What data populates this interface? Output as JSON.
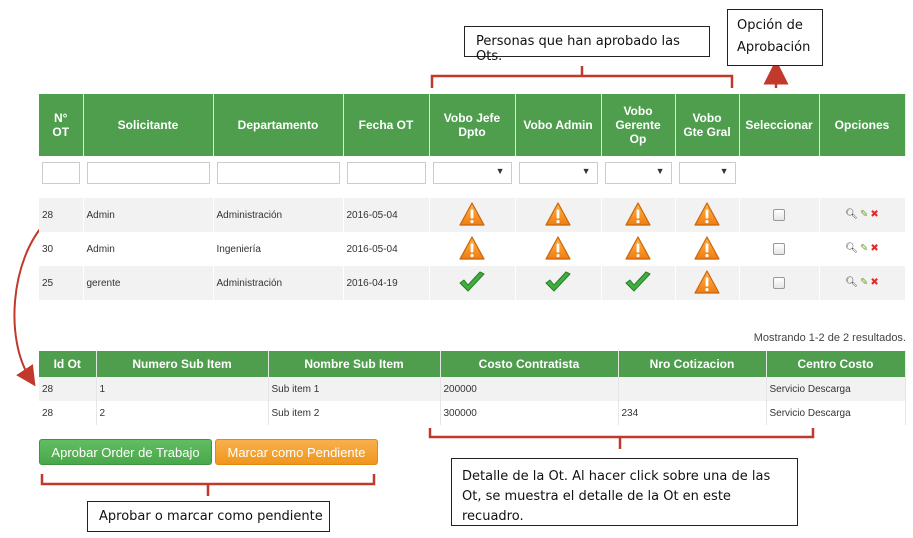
{
  "callouts": {
    "personas": "Personas que han aprobado las Ots.",
    "opcion": "Opción de Aprobación",
    "detalle": "Detalle de la Ot. Al hacer click sobre una de las Ot, se muestra el detalle de la Ot en este recuadro.",
    "aprobar": "Aprobar o marcar como pendiente"
  },
  "main_table": {
    "headers": [
      "N° OT",
      "Solicitante",
      "Departamento",
      "Fecha OT",
      "Vobo Jefe Dpto",
      "Vobo Admin",
      "Vobo Gerente Op",
      "Vobo Gte Gral",
      "Seleccionar",
      "Opciones"
    ],
    "rows": [
      {
        "ot": "28",
        "solicitante": "Admin",
        "departamento": "Administración",
        "fecha": "2016-05-04",
        "status": [
          "warning",
          "warning",
          "warning",
          "warning"
        ]
      },
      {
        "ot": "30",
        "solicitante": "Admin",
        "departamento": "Ingeniería",
        "fecha": "2016-05-04",
        "status": [
          "warning",
          "warning",
          "warning",
          "warning"
        ]
      },
      {
        "ot": "25",
        "solicitante": "gerente",
        "departamento": "Administración",
        "fecha": "2016-04-19",
        "status": [
          "approved",
          "approved",
          "approved",
          "warning"
        ]
      }
    ],
    "summary": "Mostrando 1-2 de 2 resultados."
  },
  "detail_table": {
    "headers": [
      "Id Ot",
      "Numero Sub Item",
      "Nombre Sub Item",
      "Costo Contratista",
      "Nro Cotizacion",
      "Centro Costo"
    ],
    "rows": [
      [
        "28",
        "1",
        "Sub item 1",
        "200000",
        "",
        "Servicio Descarga"
      ],
      [
        "28",
        "2",
        "Sub item 2",
        "300000",
        "234",
        "Servicio Descarga"
      ]
    ]
  },
  "buttons": {
    "approve": "Aprobar Order de Trabajo",
    "pending": "Marcar como Pendiente"
  },
  "colors": {
    "header_green": "#4e9e4e",
    "approve_button": "#5cb85c",
    "pending_button": "#f0ad4e",
    "annotation_red": "#c0392b"
  },
  "icons": {
    "warning": "warning-triangle-icon",
    "approved": "checkmark-icon",
    "view": "magnifier-icon",
    "edit": "pencil-icon",
    "delete": "delete-x-icon",
    "filter_dropdown": "chevron-down-icon"
  }
}
